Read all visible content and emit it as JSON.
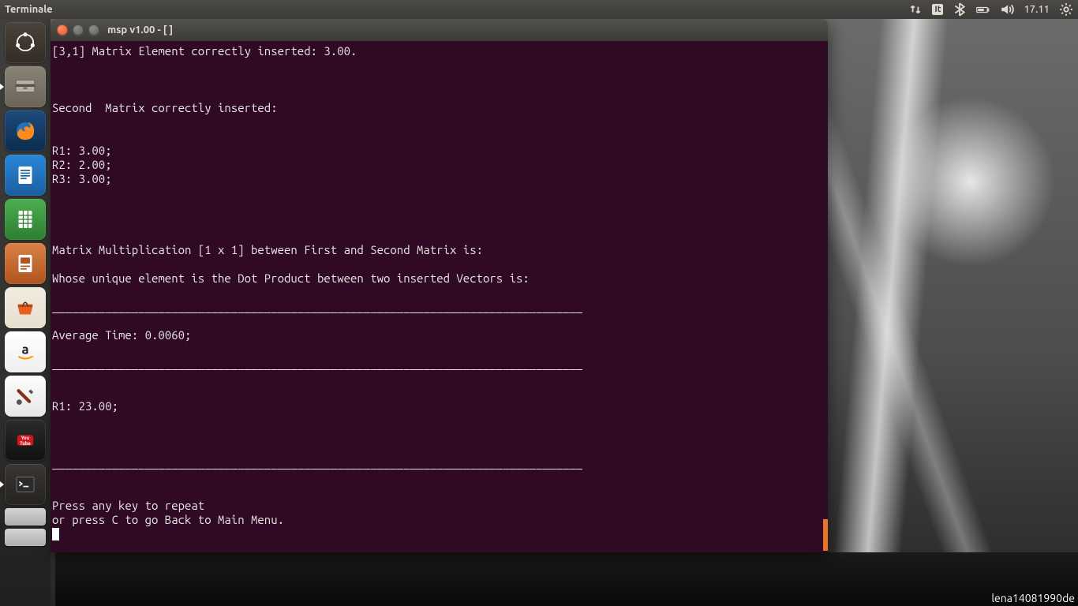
{
  "panel": {
    "app_name": "Terminale",
    "lang": "It",
    "clock": "17.11"
  },
  "launcher": {
    "items": [
      {
        "name": "dash",
        "bg": "#3b3631",
        "running": false
      },
      {
        "name": "files",
        "bg": "#6f6a62",
        "running": true
      },
      {
        "name": "firefox",
        "bg": "#14375f",
        "running": false
      },
      {
        "name": "writer",
        "bg": "#1f74c4",
        "running": false
      },
      {
        "name": "calc",
        "bg": "#3d9a3f",
        "running": false
      },
      {
        "name": "impress",
        "bg": "#c75626",
        "running": false
      },
      {
        "name": "software",
        "bg": "#d7612b",
        "running": false
      },
      {
        "name": "amazon",
        "bg": "#f4f4f4",
        "running": false
      },
      {
        "name": "settings",
        "bg": "#efefef",
        "running": false
      },
      {
        "name": "youtube",
        "bg": "#222222",
        "running": false
      },
      {
        "name": "terminal",
        "bg": "#2d2b28",
        "running": true
      }
    ],
    "collapsed": [
      {
        "name": "device-1",
        "bg": "#bdbdbd"
      },
      {
        "name": "device-2",
        "bg": "#bdbdbd"
      }
    ]
  },
  "window": {
    "title": "msp v1.00 - [ ]"
  },
  "terminal": {
    "lines": [
      "[3,1] Matrix Element correctly inserted: 3.00.",
      "",
      "",
      "",
      "Second  Matrix correctly inserted:",
      "",
      "",
      "R1: 3.00;",
      "R2: 2.00;",
      "R3: 3.00;",
      "",
      "",
      "",
      "",
      "Matrix Multiplication [1 x 1] between First and Second Matrix is:",
      "",
      "Whose unique element is the Dot Product between two inserted Vectors is:",
      "",
      "________________________________________________________________________________",
      "",
      "Average Time: 0.0060;",
      "",
      "________________________________________________________________________________",
      "",
      "",
      "R1: 23.00;",
      "",
      "",
      "",
      "________________________________________________________________________________",
      "",
      "",
      "Press any key to repeat",
      "or press C to go Back to Main Menu."
    ]
  },
  "wallpaper": {
    "credit": "lena14081990de"
  }
}
